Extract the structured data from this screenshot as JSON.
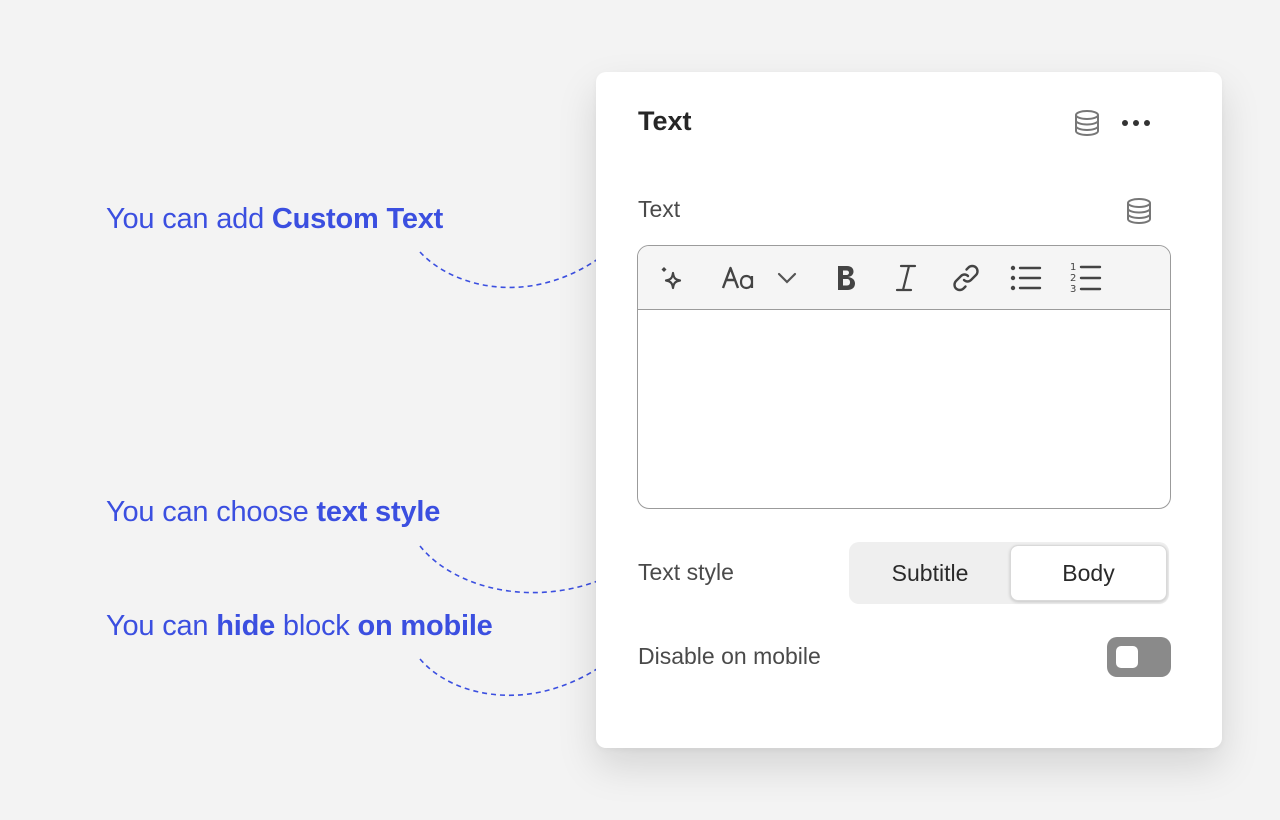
{
  "annotations": [
    {
      "parts": [
        {
          "text": "You can add ",
          "bold": false
        },
        {
          "text": "Custom Text",
          "bold": true
        }
      ]
    },
    {
      "parts": [
        {
          "text": "You can choose ",
          "bold": false
        },
        {
          "text": "text style",
          "bold": true
        }
      ]
    },
    {
      "parts": [
        {
          "text": "You can ",
          "bold": false
        },
        {
          "text": "hide",
          "bold": true
        },
        {
          "text": " block ",
          "bold": false
        },
        {
          "text": "on mobile",
          "bold": true
        }
      ]
    }
  ],
  "colors": {
    "accent": "#3b4fe0",
    "background": "#f3f3f3",
    "panel": "#ffffff",
    "toggle_off": "#8a8a8a"
  },
  "panel": {
    "title": "Text",
    "header_icons": [
      "database-icon",
      "more-horizontal-icon"
    ],
    "text_field": {
      "label": "Text",
      "label_icon": "database-icon",
      "toolbar": [
        "ai-sparkle-icon",
        "font-size-icon",
        "chevron-down-icon",
        "bold-icon",
        "italic-icon",
        "link-icon",
        "bullet-list-icon",
        "numbered-list-icon"
      ],
      "value": ""
    },
    "text_style": {
      "label": "Text style",
      "options": [
        "Subtitle",
        "Body"
      ],
      "selected": "Body"
    },
    "disable_mobile": {
      "label": "Disable on mobile",
      "enabled": false
    }
  }
}
